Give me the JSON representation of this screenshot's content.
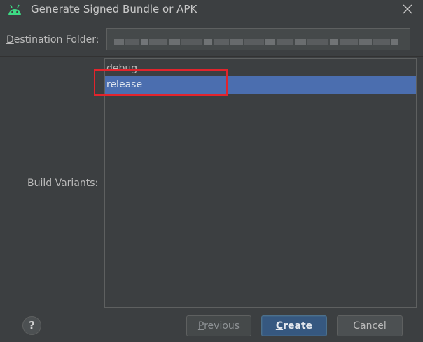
{
  "dialog": {
    "title": "Generate Signed Bundle or APK",
    "icon": "android-icon",
    "close_icon": "close-icon"
  },
  "destination": {
    "label_mnemonic": "D",
    "label_rest": "estination Folder:",
    "value_redacted": true
  },
  "build_variants": {
    "label_mnemonic": "B",
    "label_rest": "uild Variants:",
    "items": [
      {
        "label": "debug",
        "selected": false
      },
      {
        "label": "release",
        "selected": true
      }
    ]
  },
  "buttons": {
    "help": "?",
    "previous_mnemonic": "P",
    "previous_rest": "revious",
    "create_mnemonic": "C",
    "create_rest": "reate",
    "cancel": "Cancel"
  },
  "colors": {
    "background": "#3c3f41",
    "selection": "#4b6eaf",
    "primary_button": "#365880",
    "annotation_box": "#e2242c",
    "android_green": "#3ddc84"
  }
}
